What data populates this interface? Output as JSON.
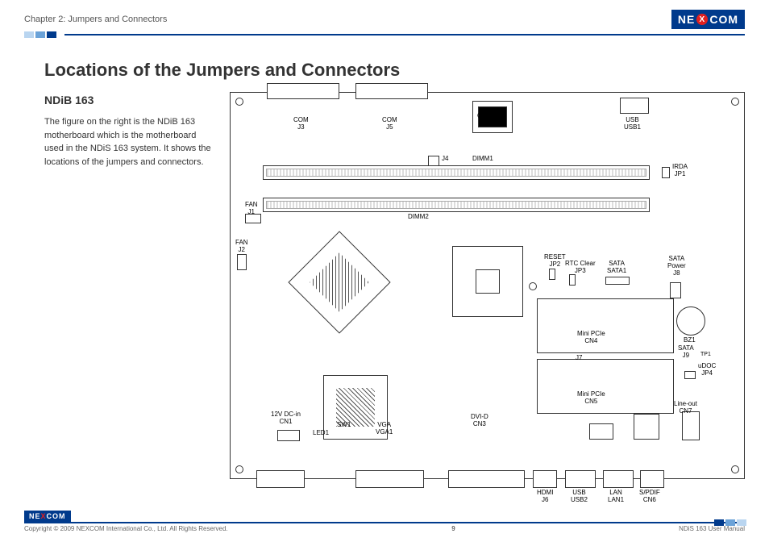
{
  "header": {
    "chapter": "Chapter 2: Jumpers and Connectors",
    "brand_left": "NE",
    "brand_x": "X",
    "brand_right": "COM"
  },
  "page": {
    "title": "Locations of the Jumpers and Connectors",
    "subtitle": "NDiB 163",
    "body": "The figure on the right is the NDiB 163 motherboard which is the motherboard used in the NDiS 163 system. It shows the locations of the jumpers and connectors."
  },
  "labels": {
    "com_j3": "COM\nJ3",
    "com_j5": "COM\nJ5",
    "gpio_cn2": "GPIO\nCN2",
    "usb_usb1": "USB\nUSB1",
    "j4": "J4",
    "dimm1": "DIMM1",
    "dimm2": "DIMM2",
    "irda_jp1": "IRDA\nJP1",
    "fan_j1": "FAN\nJ1",
    "fan_j2": "FAN\nJ2",
    "reset_jp2": "RESET\nJP2",
    "rtc_clear_jp3": "RTC Clear\nJP3",
    "sata_sata1": "SATA\nSATA1",
    "sata_power_j8": "SATA\nPower\nJ8",
    "mini_pcie_cn4": "Mini PCIe\nCN4",
    "mini_pcie_cn5": "Mini PCIe\nCN5",
    "j7": "J7",
    "bz1": "BZ1",
    "sata_j9": "SATA\nJ9",
    "tp1": "TP1",
    "udoc_jp4": "uDOC\nJP4",
    "line_out_cn7": "Line-out\nCN7",
    "twelve_v_dc_in_cn1": "12V DC-in\nCN1",
    "led1": "LED1",
    "sw1": "SW1",
    "vga_vga1": "VGA\nVGA1",
    "dvi_d_cn3": "DVI-D\nCN3",
    "hdmi_j6": "HDMI\nJ6",
    "usb_usb2": "USB\nUSB2",
    "lan_lan1": "LAN\nLAN1",
    "spdif_cn6": "S/PDIF\nCN6"
  },
  "footer": {
    "copyright": "Copyright © 2009 NEXCOM International Co., Ltd. All Rights Reserved.",
    "page_number": "9",
    "manual": "NDiS 163 User Manual",
    "brand": "NE COM"
  }
}
